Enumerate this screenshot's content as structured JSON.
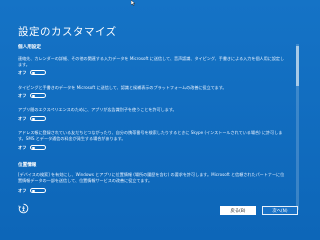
{
  "window": {
    "title": "設定のカスタマイズ"
  },
  "sections": [
    {
      "heading": "個人用設定",
      "items": [
        {
          "description": "連絡先、カレンダーの詳細、その他の関連する入力データを Microsoft に送信して、音声認識、タイピング、手書きによる入力を個人用に設定します。",
          "toggle_label": "オフ",
          "state": "off"
        },
        {
          "description": "タイピングと手書きのデータを Microsoft に送信して、認識と候補表示のプラットフォームの改善に役立てます。",
          "toggle_label": "オフ",
          "state": "off"
        },
        {
          "description": "アプリ間のエクスペリエンスのために、アプリが広告識別子を使うことを許可します。",
          "toggle_label": "オフ",
          "state": "off"
        },
        {
          "description": "アドレス帳に登録されている友だちとつながったり、自分の携帯番号を検索したりするときに Skype (インストールされている場合) に許可します。SMS とデータ通信の料金が発生する場合があります。",
          "toggle_label": "オフ",
          "state": "off"
        }
      ]
    },
    {
      "heading": "位置情報",
      "items": [
        {
          "description": "[デバイスの検索] を有効にし、Windows とアプリに位置情報 (場所の履歴を含む) の要求を許可します。Microsoft と信頼されたパートナーに位置情報データの一部を送信して、位置情報サービスの改善に役立てます。",
          "toggle_label": "オフ",
          "state": "off"
        }
      ]
    }
  ],
  "footer": {
    "back_label": "戻る(B)",
    "next_label": "次へ(N)"
  },
  "colors": {
    "background": "#0f6cbd",
    "text": "#ffffff"
  },
  "icons": {
    "ease_of_access": "ease-of-access-icon",
    "cursor": "mouse-cursor-icon"
  }
}
